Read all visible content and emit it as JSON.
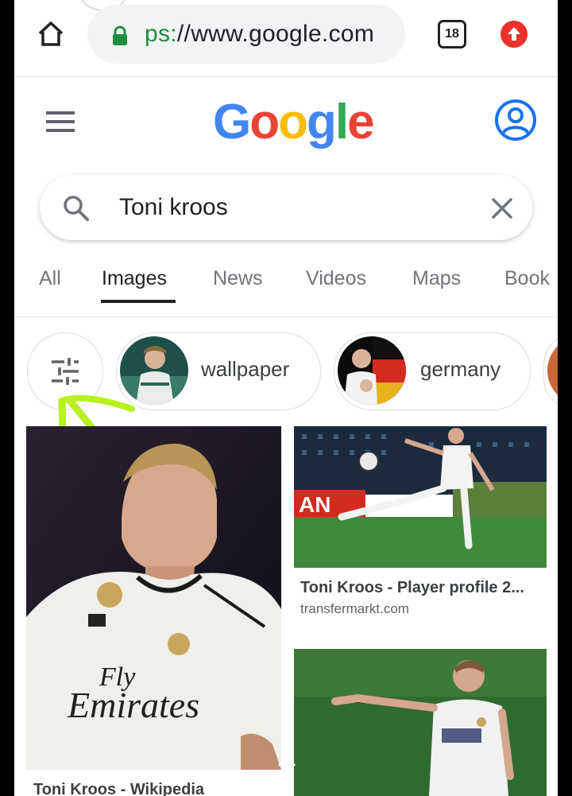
{
  "browser": {
    "url_scheme": "ps:",
    "url_rest": "//www.google.com",
    "tab_count": "18"
  },
  "header": {
    "logo_letters": [
      "G",
      "o",
      "o",
      "g",
      "l",
      "e"
    ],
    "logo_colors": [
      "#4285f4",
      "#ea4335",
      "#fbbc05",
      "#4285f4",
      "#34a853",
      "#ea4335"
    ]
  },
  "search": {
    "value": "Toni kroos"
  },
  "tabs": [
    {
      "label": "All"
    },
    {
      "label": "Images"
    },
    {
      "label": "News"
    },
    {
      "label": "Videos"
    },
    {
      "label": "Maps"
    },
    {
      "label": "Book"
    }
  ],
  "chips": [
    {
      "label": "wallpaper"
    },
    {
      "label": "germany"
    }
  ],
  "results": [
    {
      "title": "Toni Kroos - Wikipedia",
      "source": ""
    },
    {
      "title": "Toni Kroos - Player profile 2...",
      "source": "transfermarkt.com"
    },
    {
      "title": "",
      "source": ""
    }
  ],
  "photo_text": {
    "shirt_sponsor_line1": "Fly",
    "shirt_sponsor_line2": "Emirates",
    "banner_letters": "AN"
  },
  "colors": {
    "accent_blue": "#1a73e8",
    "secure_green": "#1e8e3e",
    "annotation": "#b8f020",
    "update_red": "#e8322a"
  }
}
